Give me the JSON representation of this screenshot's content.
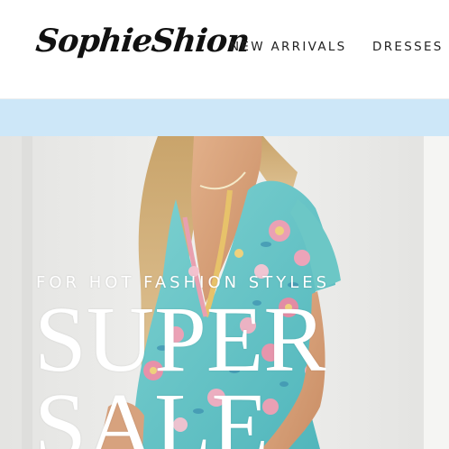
{
  "header": {
    "logo_text": "SophieShion",
    "nav": [
      {
        "label": "NEW ARRIVALS"
      },
      {
        "label": "DRESSES"
      }
    ]
  },
  "hero": {
    "subtitle": "FOR HOT FASHION STYLES",
    "title": "SUPER\nSALE"
  },
  "colors": {
    "announcement_bar": "#cde7f8",
    "hero_text": "#ffffff",
    "nav_text": "#222222"
  }
}
